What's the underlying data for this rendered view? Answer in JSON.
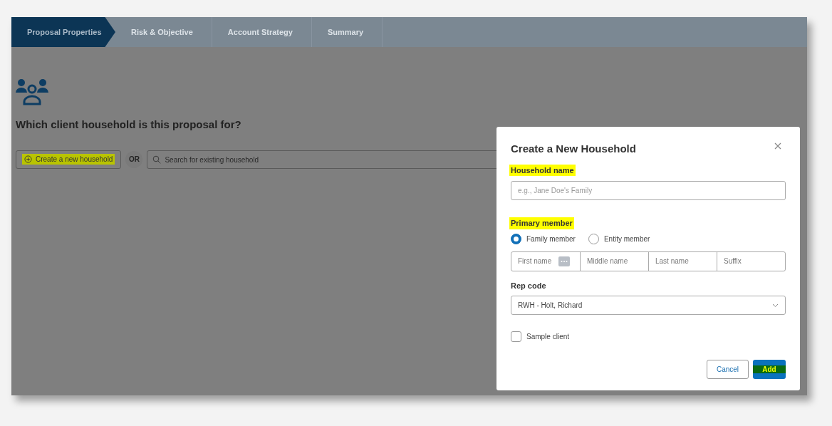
{
  "steps": [
    {
      "label": "Proposal Properties",
      "selected": true
    },
    {
      "label": "Risk & Objective",
      "selected": false
    },
    {
      "label": "Account Strategy",
      "selected": false
    },
    {
      "label": "Summary",
      "selected": false
    }
  ],
  "page": {
    "question": "Which client household is this proposal for?",
    "create_button": {
      "label": "Create a new household",
      "highlighted": true
    },
    "or_label": "OR",
    "search": {
      "placeholder": "Search for existing household"
    }
  },
  "dialog": {
    "title": "Create a New Household",
    "household_name": {
      "label": "Household name",
      "highlighted": true,
      "placeholder": "e.g., Jane Doe's Family"
    },
    "primary_member": {
      "label": "Primary member",
      "highlighted": true,
      "options": [
        {
          "label": "Family member",
          "selected": true
        },
        {
          "label": "Entity member",
          "selected": false
        }
      ],
      "name_fields": [
        {
          "placeholder": "First name",
          "has_menu": true
        },
        {
          "placeholder": "Middle name",
          "has_menu": false
        },
        {
          "placeholder": "Last name",
          "has_menu": false
        },
        {
          "placeholder": "Suffix",
          "has_menu": false
        }
      ]
    },
    "rep_code": {
      "label": "Rep code",
      "value": "RWH - Holt, Richard"
    },
    "sample_client": {
      "label": "Sample client",
      "checked": false
    },
    "buttons": [
      {
        "label": "Cancel",
        "kind": "secondary",
        "highlighted": false
      },
      {
        "label": "Add",
        "kind": "primary",
        "highlighted": true
      }
    ]
  }
}
